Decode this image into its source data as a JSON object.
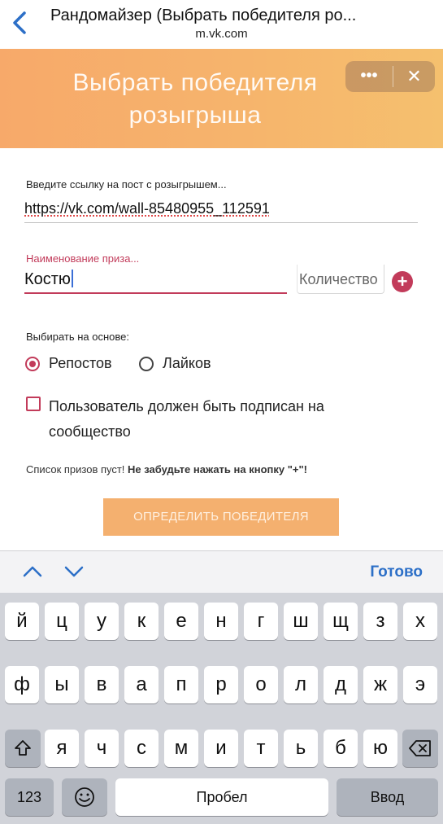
{
  "browser": {
    "title": "Рандомайзер (Выбрать победителя ро...",
    "url": "m.vk.com"
  },
  "header": {
    "title": "Выбрать победителя розыгрыша",
    "more_label": "•••",
    "close_label": "✕"
  },
  "form": {
    "post_link_label": "Введите ссылку на пост с розыгрышем...",
    "post_link_value": "https://vk.com/wall-85480955_112591",
    "prize_label": "Наименование приза...",
    "prize_value": "Костю",
    "quantity_placeholder": "Количество",
    "basis_label": "Выбирать на основе:",
    "basis_options": [
      {
        "label": "Репостов",
        "selected": true
      },
      {
        "label": "Лайков",
        "selected": false
      }
    ],
    "subscribed_label": "Пользователь должен быть подписан на сообщество",
    "subscribed_checked": false,
    "note_plain": "Список призов пуст! ",
    "note_bold": "Не забудьте нажать на кнопку \"+\"!",
    "action_label": "ОПРЕДЕЛИТЬ ПОБЕДИТЕЛЯ"
  },
  "accessory": {
    "done_label": "Готово"
  },
  "keyboard": {
    "row1": [
      "й",
      "ц",
      "у",
      "к",
      "е",
      "н",
      "г",
      "ш",
      "щ",
      "з",
      "х"
    ],
    "row2": [
      "ф",
      "ы",
      "в",
      "а",
      "п",
      "р",
      "о",
      "л",
      "д",
      "ж",
      "э"
    ],
    "row3": [
      "я",
      "ч",
      "с",
      "м",
      "и",
      "т",
      "ь",
      "б",
      "ю"
    ],
    "numbers_label": "123",
    "space_label": "Пробел",
    "return_label": "Ввод"
  },
  "colors": {
    "accent": "#c23b5a",
    "header_orange": "#f6b46c",
    "link_blue": "#2c6fc7"
  }
}
